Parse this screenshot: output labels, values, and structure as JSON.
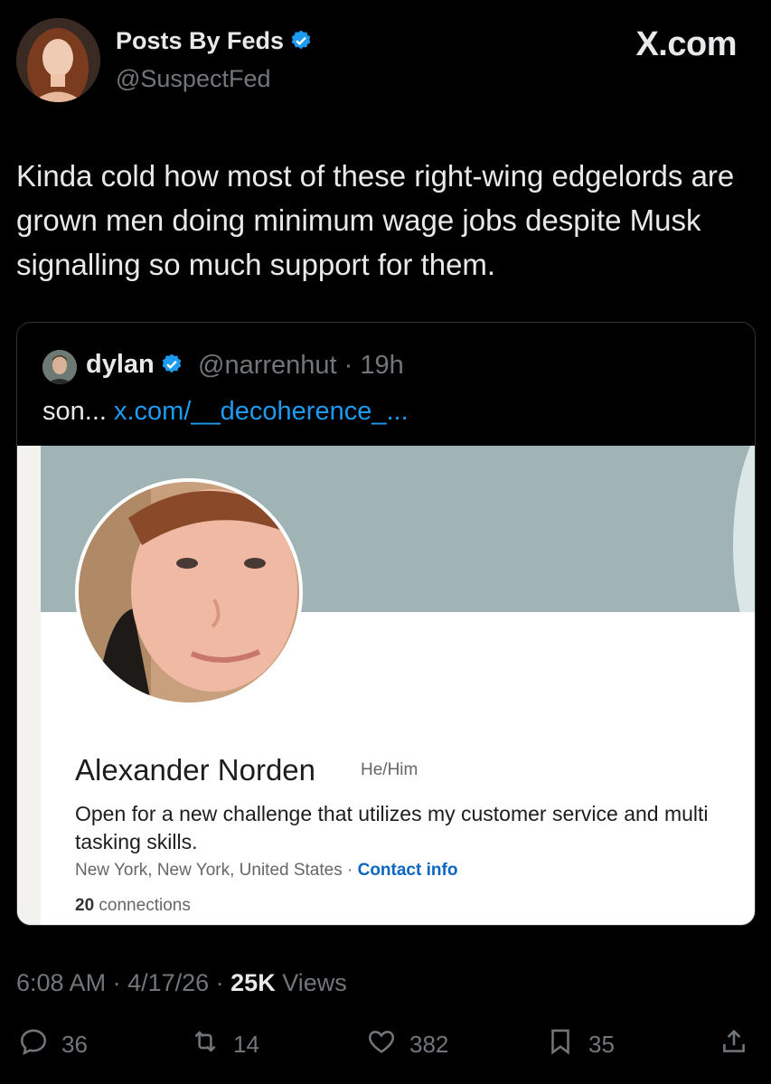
{
  "author": {
    "display_name": "Posts By Feds",
    "handle": "@SuspectFed",
    "verified_icon": "verified-badge-icon"
  },
  "brand": "X.com",
  "tweet": {
    "text": "Kinda cold how most of these right-wing edgelords are grown men doing minimum wage jobs despite Musk signalling so much support for them."
  },
  "quote": {
    "name": "dylan",
    "handle_time": "@narrenhut · 19h",
    "text_prefix": "son... ",
    "link": "x.com/__decoherence_..."
  },
  "linkedin": {
    "name": "Alexander Norden",
    "pronouns": "He/Him",
    "headline": "Open for a new challenge that utilizes my customer service and multi tasking skills.",
    "location": "New York, New York, United States",
    "separator": " · ",
    "contact": "Contact info",
    "connections_count": "20",
    "connections_label": "connections"
  },
  "meta": {
    "time": "6:08 AM",
    "date": "4/17/26",
    "views_count": "25K",
    "views_label": "Views",
    "sep": " · "
  },
  "actions": {
    "replies": "36",
    "reposts": "14",
    "likes": "382",
    "bookmarks": "35"
  },
  "colors": {
    "accent": "#1d9bf0",
    "linkedin_blue": "#0a66c2",
    "muted": "#71767b"
  }
}
